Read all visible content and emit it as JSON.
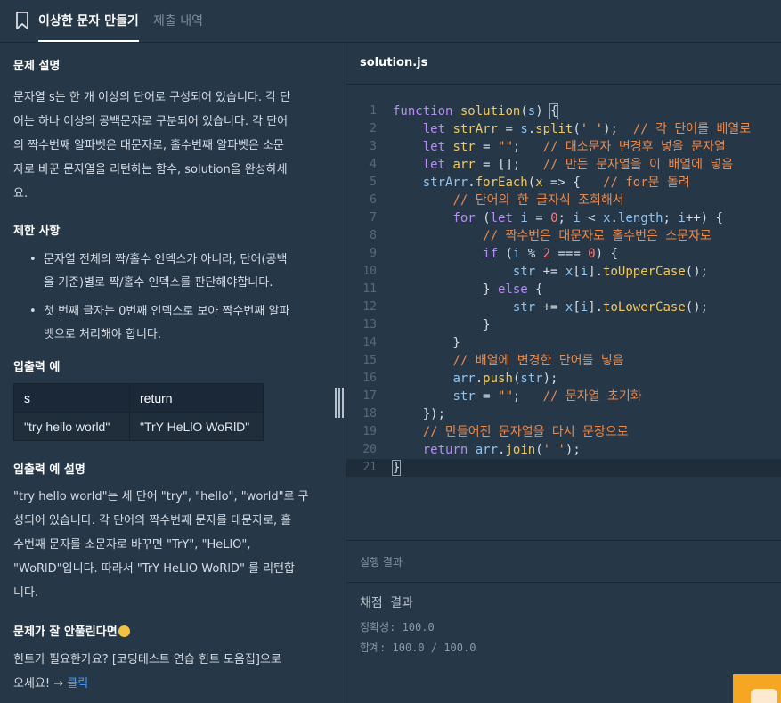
{
  "header": {
    "tabs": [
      {
        "label": "이상한 문자 만들기",
        "active": true
      },
      {
        "label": "제출 내역",
        "active": false
      }
    ]
  },
  "problem": {
    "description_title": "문제 설명",
    "description_lines": [
      "문자열 s는 한 개 이상의 단어로 구성되어 있습니다. 각 단",
      "어는 하나 이상의 공백문자로 구분되어 있습니다. 각 단어",
      "의 짝수번째 알파벳은 대문자로, 홀수번째 알파벳은 소문",
      "자로 바꾼 문자열을 리턴하는 함수, solution을 완성하세",
      "요."
    ],
    "limits_title": "제한 사항",
    "limits": [
      {
        "line1": "문자열 전체의 짝/홀수 인덱스가 아니라, 단어(공백",
        "line2": "을 기준)별로 짝/홀수 인덱스를 판단해야합니다."
      },
      {
        "line1": "첫 번째 글자는 0번째 인덱스로 보아 짝수번째 알파",
        "line2": "벳으로 처리해야 합니다."
      }
    ],
    "io_title": "입출력 예",
    "io_table": {
      "headers": [
        "s",
        "return"
      ],
      "rows": [
        [
          "\"try hello world\"",
          "\"TrY HeLlO WoRlD\""
        ]
      ]
    },
    "io_desc_title": "입출력 예 설명",
    "io_desc_lines": [
      "\"try hello world\"는 세 단어 \"try\", \"hello\", \"world\"로 구",
      "성되어 있습니다. 각 단어의 짝수번째 문자를 대문자로, 홀",
      "수번째 문자를 소문자로 바꾸면 \"TrY\", \"HeLlO\",",
      "\"WoRlD\"입니다. 따라서 \"TrY HeLlO WoRlD\" 를 리턴합",
      "니다."
    ],
    "hint_title": "문제가 잘 안풀린다면",
    "hint_line1": "힌트가 필요한가요? [코딩테스트 연습 힌트 모음집]으로",
    "hint_line2_prefix": "오세요! → ",
    "hint_link": "클릭"
  },
  "editor": {
    "file_name": "solution.js",
    "line_numbers": [
      "1",
      "2",
      "3",
      "4",
      "5",
      "6",
      "7",
      "8",
      "9",
      "10",
      "11",
      "12",
      "13",
      "14",
      "15",
      "16",
      "17",
      "18",
      "19",
      "20",
      "21"
    ],
    "current_line": 21
  },
  "result": {
    "title": "실행 결과",
    "heading": "채점 결과",
    "accuracy": "정확성: 100.0",
    "total": "합계: 100.0 / 100.0"
  },
  "colors": {
    "background": "#263747",
    "panel_dark": "#1b2838",
    "link": "#44a0ff",
    "keyword": "#b48ef0",
    "function": "#f0c860",
    "comment": "#e98a4e"
  }
}
